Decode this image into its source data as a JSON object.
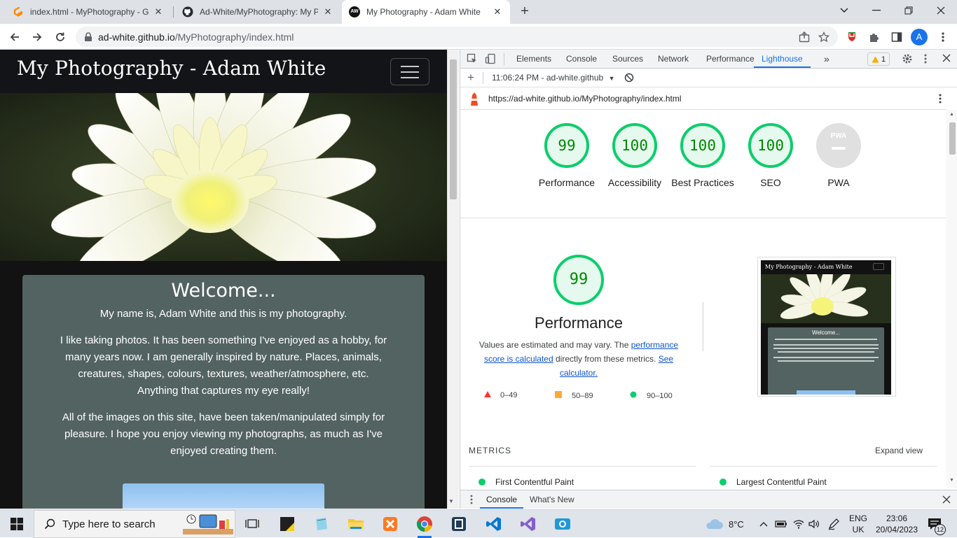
{
  "browser": {
    "tabs": [
      {
        "title": "index.html - MyPhotography - Gi"
      },
      {
        "title": "Ad-White/MyPhotography: My Ph"
      },
      {
        "title": "My Photography - Adam White",
        "favicon_text": "AW"
      }
    ],
    "url_host": "ad-white.github.io",
    "url_path": "/MyPhotography/index.html",
    "profile_initial": "A"
  },
  "page": {
    "brand": "My Photography - Adam White",
    "welcome_title": "Welcome...",
    "intro": "My name is, Adam White and this is my photography.",
    "para1": "I like taking photos. It has been something I've enjoyed as a hobby, for many years now. I am generally inspired by nature. Places, animals, creatures, shapes, colours, textures, weather/atmosphere, etc. Anything that captures my eye really!",
    "para2": "All of the images on this site, have been taken/manipulated simply for pleasure. I hope you enjoy viewing my photographs, as much as I've enjoyed creating them."
  },
  "devtools": {
    "tabs": [
      "Elements",
      "Console",
      "Sources",
      "Network",
      "Performance",
      "Lighthouse"
    ],
    "active_tab": "Lighthouse",
    "warning_count": "1",
    "report_selector": "11:06:24 PM - ad-white.github",
    "report_url": "https://ad-white.github.io/MyPhotography/index.html",
    "scores": [
      {
        "label": "Performance",
        "value": "99"
      },
      {
        "label": "Accessibility",
        "value": "100"
      },
      {
        "label": "Best Practices",
        "value": "100"
      },
      {
        "label": "SEO",
        "value": "100"
      }
    ],
    "pwa_label": "PWA",
    "pwa_badge": "PWA",
    "perf_score": "99",
    "perf_title": "Performance",
    "perf_desc_1": "Values are estimated and may vary. The ",
    "perf_link_1": "performance score is calculated",
    "perf_desc_2": " directly from these metrics. ",
    "perf_link_2": "See calculator.",
    "legend": [
      {
        "range": "0–49",
        "color": "#ff3333",
        "shape": "triangle"
      },
      {
        "range": "50–89",
        "color": "#ffaa33",
        "shape": "square"
      },
      {
        "range": "90–100",
        "color": "#0cce6b",
        "shape": "circle"
      }
    ],
    "thumb_title": "My Photography - Adam White",
    "thumb_welcome": "Welcome...",
    "metrics_heading": "METRICS",
    "expand_view": "Expand view",
    "metrics": [
      "First Contentful Paint",
      "Largest Contentful Paint"
    ],
    "drawer_tabs": [
      "Console",
      "What's New"
    ]
  },
  "taskbar": {
    "search_placeholder": "Type here to search",
    "weather": "8°C",
    "lang_1": "ENG",
    "lang_2": "UK",
    "time": "23:06",
    "date": "20/04/2023",
    "notifications": "12"
  }
}
